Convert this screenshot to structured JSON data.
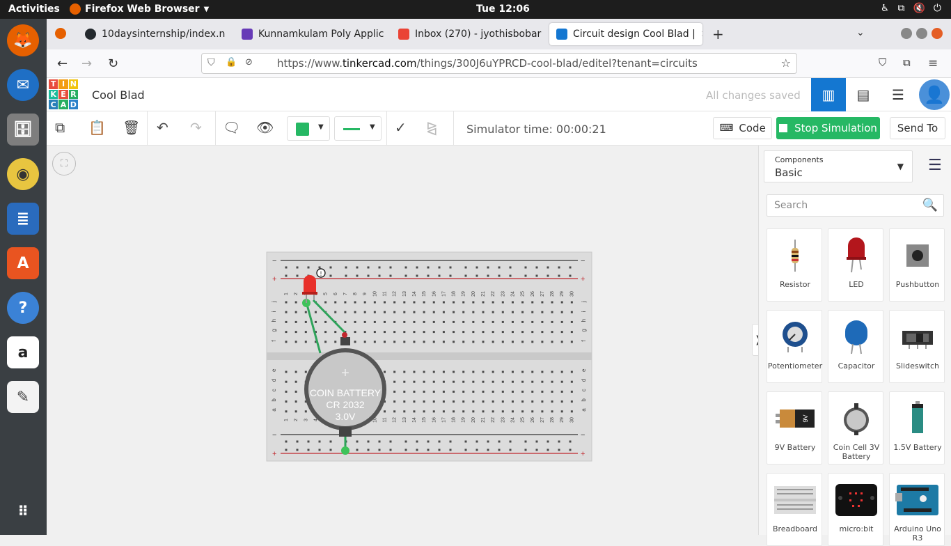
{
  "system": {
    "activities": "Activities",
    "app_name": "Firefox Web Browser",
    "clock": "Tue 12:06"
  },
  "browser": {
    "tabs": [
      {
        "label": "10daysinternship/index.n",
        "color": "#24292e"
      },
      {
        "label": "Kunnamkulam Poly Applic",
        "color": "#673ab7"
      },
      {
        "label": "Inbox (270) - jyothisbobar",
        "color": "#ea4335"
      },
      {
        "label": "Circuit design Cool Blad |",
        "color": "#1477d1"
      }
    ],
    "url_prefix": "https://www.",
    "url_domain": "tinkercad.com",
    "url_path": "/things/300J6uYPRCD-cool-blad/editel?tenant=circuits"
  },
  "app": {
    "logo_letters": [
      "T",
      "I",
      "N",
      "K",
      "E",
      "R",
      "C",
      "A",
      "D"
    ],
    "project_name": "Cool Blad",
    "save_status": "All changes saved",
    "simulator_time": "Simulator time: 00:00:21",
    "code_label": "Code",
    "stop_label": "Stop Simulation",
    "send_label": "Send To",
    "accent": "#1477d1",
    "go_color": "#26b864"
  },
  "panel": {
    "components_label": "Components",
    "components_value": "Basic",
    "search_placeholder": "Search",
    "parts": [
      {
        "name": "Resistor",
        "icon": "resistor-icon"
      },
      {
        "name": "LED",
        "icon": "led-icon"
      },
      {
        "name": "Pushbutton",
        "icon": "pushbutton-icon"
      },
      {
        "name": "Potentiometer",
        "icon": "potentiometer-icon"
      },
      {
        "name": "Capacitor",
        "icon": "capacitor-icon"
      },
      {
        "name": "Slideswitch",
        "icon": "slideswitch-icon"
      },
      {
        "name": "9V Battery",
        "icon": "battery-9v-icon"
      },
      {
        "name": "Coin Cell 3V Battery",
        "icon": "coin-cell-icon"
      },
      {
        "name": "1.5V Battery",
        "icon": "battery-aa-icon"
      },
      {
        "name": "Breadboard",
        "icon": "breadboard-icon"
      },
      {
        "name": "micro:bit",
        "icon": "microbit-icon"
      },
      {
        "name": "Arduino Uno R3",
        "icon": "arduino-icon"
      }
    ]
  },
  "circuit": {
    "battery_line1": "COIN BATTERY",
    "battery_line2": "CR 2032",
    "battery_line3": "3.0V",
    "row_labels_top": "j i h g f",
    "row_labels_bottom": "e d c b a",
    "battery_9v_text": "9V"
  }
}
